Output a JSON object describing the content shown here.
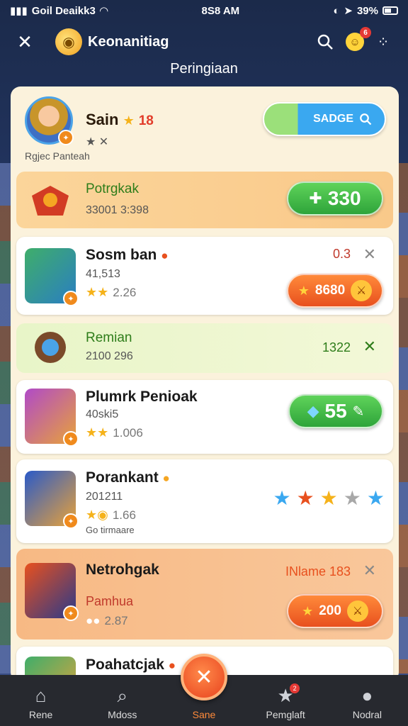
{
  "status_bar": {
    "carrier": "Goil Deaikk3",
    "time": "8S8 AM",
    "battery": "39%"
  },
  "top_nav": {
    "app_title": "Keonanitiag",
    "notification_count": "6"
  },
  "page_heading": "Peringiaan",
  "profile": {
    "name": "Sain",
    "level": "18",
    "sub": "★ ✕",
    "caption": "Rgjec Panteah",
    "search_label": "SADGE"
  },
  "rows": [
    {
      "title": "Potrgkak",
      "sub": "33001 3:398",
      "action": "330",
      "style": "orange"
    },
    {
      "title": "Sosm ban",
      "sub": "41,513",
      "rating": "2.26",
      "small_value": "0.3",
      "action": "8680",
      "style": "white"
    },
    {
      "title": "Remian",
      "sub": "2100 296",
      "small_value": "1322",
      "style": "green"
    },
    {
      "title": "Plumrk Penioak",
      "sub": "40ski5",
      "rating": "1.006",
      "action": "55",
      "style": "white"
    },
    {
      "title": "Porankant",
      "sub": "201211",
      "rating": "1.66",
      "caption": "Go tirmaare",
      "style": "white"
    },
    {
      "title": "Netrohgak",
      "sub": "Pamhua",
      "rating": "2.87",
      "small_value": "INlame 183",
      "action": "200",
      "style": "peach"
    },
    {
      "title": "Poahatcjak",
      "style": "white"
    }
  ],
  "tabs": [
    {
      "label": "Rene",
      "icon": "home-icon"
    },
    {
      "label": "Mdoss",
      "icon": "search-icon"
    },
    {
      "label": "Sane",
      "icon": "close-icon"
    },
    {
      "label": "Pemglaft",
      "icon": "star-icon",
      "badge": "2"
    },
    {
      "label": "Nodral",
      "icon": "profile-icon"
    }
  ],
  "colors": {
    "accent_orange": "#ff8a3a",
    "accent_green": "#2ea43a",
    "accent_blue": "#3aa8f0",
    "panel": "#fbf2dc"
  }
}
